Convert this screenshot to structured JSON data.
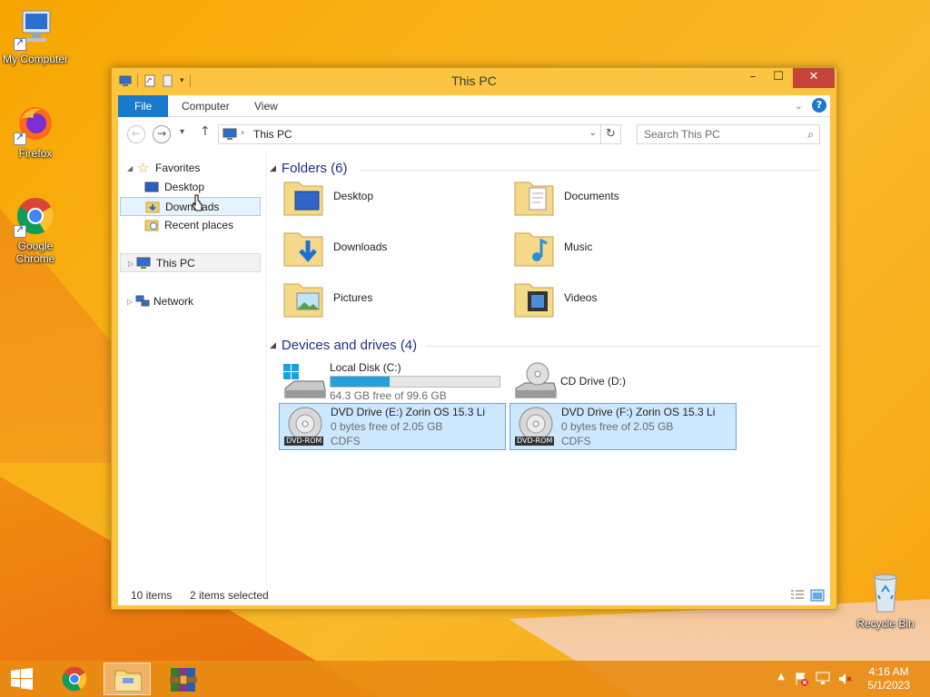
{
  "desktop": {
    "icons": [
      {
        "label": "My Computer",
        "icon": "computer-icon"
      },
      {
        "label": "Firefox",
        "icon": "firefox-icon"
      },
      {
        "label": "Google Chrome",
        "icon": "chrome-icon"
      },
      {
        "label": "Recycle Bin",
        "icon": "recycle-bin-icon"
      }
    ]
  },
  "window": {
    "title": "This PC",
    "ribbon": {
      "tabs": [
        "File",
        "Computer",
        "View"
      ]
    },
    "address": {
      "path": "This PC"
    },
    "search": {
      "placeholder": "Search This PC"
    },
    "nav": {
      "favorites": "Favorites",
      "favorites_items": [
        "Desktop",
        "Downloads",
        "Recent places"
      ],
      "this_pc": "This PC",
      "network": "Network"
    },
    "folders_header": "Folders (6)",
    "folders": [
      "Desktop",
      "Documents",
      "Downloads",
      "Music",
      "Pictures",
      "Videos"
    ],
    "drives_header": "Devices and drives (4)",
    "drives": [
      {
        "name": "Local Disk (C:)",
        "free": "64.3 GB free of 99.6 GB",
        "used_fraction": 0.35
      },
      {
        "name": "CD Drive (D:)"
      },
      {
        "name": "DVD Drive (E:) Zorin OS 15.3 Li",
        "free": "0 bytes free of 2.05 GB",
        "fs": "CDFS",
        "tag": "DVD-ROM"
      },
      {
        "name": "DVD Drive (F:) Zorin OS 15.3 Li",
        "free": "0 bytes free of 2.05 GB",
        "fs": "CDFS",
        "tag": "DVD-ROM"
      }
    ],
    "status": {
      "items": "10 items",
      "selected": "2 items selected"
    }
  },
  "taskbar": {
    "time": "4:16 AM",
    "date": "5/1/2023"
  },
  "colors": {
    "accent": "#1979ca",
    "selection": "#cce8ff",
    "header_blue": "#1e3287",
    "progress": "#26a0da"
  }
}
